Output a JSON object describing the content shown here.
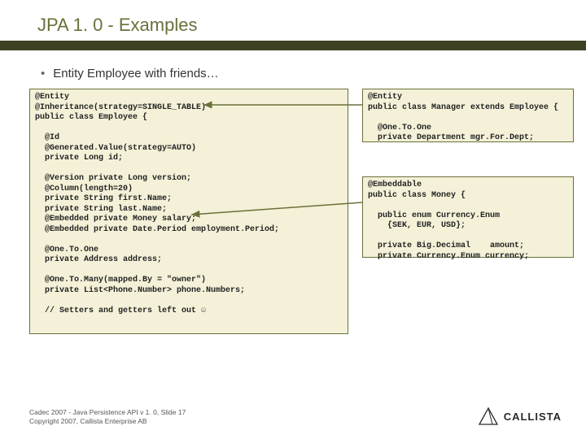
{
  "title": "JPA 1. 0 - Examples",
  "bullet": "Entity Employee with friends…",
  "code": {
    "main": "@Entity\n@Inheritance(strategy=SINGLE_TABLE)\npublic class Employee {\n\n  @Id\n  @Generated.Value(strategy=AUTO)\n  private Long id;\n\n  @Version private Long version;\n  @Column(length=20)\n  private String first.Name;\n  private String last.Name;\n  @Embedded private Money salary;\n  @Embedded private Date.Period employment.Period;\n\n  @One.To.One\n  private Address address;\n\n  @One.To.Many(mapped.By = \"owner\")\n  private List<Phone.Number> phone.Numbers;\n\n  // Setters and getters left out ☺",
    "manager": "@Entity\npublic class Manager extends Employee {\n\n  @One.To.One\n  private Department mgr.For.Dept;",
    "money": "@Embeddable\npublic class Money {\n\n  public enum Currency.Enum\n    {SEK, EUR, USD};\n\n  private Big.Decimal    amount;\n  private Currency.Enum currency;"
  },
  "footer": {
    "line1": "Cadec 2007 - Java Persistence API v 1. 0, Slide 17",
    "line2": "Copyright 2007, Callista Enterprise AB"
  },
  "logo": "CALLISTA",
  "colors": {
    "accent": "#6a703a",
    "bar": "#3f4222",
    "codebg": "#f4f1d8"
  }
}
